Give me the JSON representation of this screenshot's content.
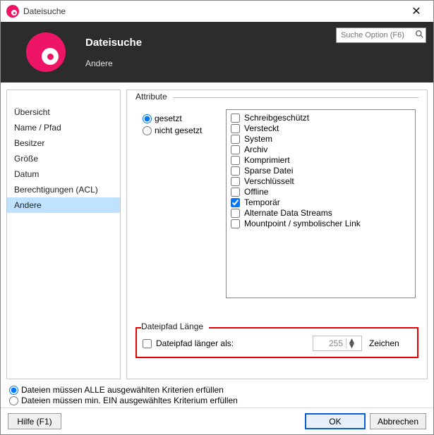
{
  "window": {
    "title": "Dateisuche"
  },
  "header": {
    "title": "Dateisuche",
    "subtitle": "Andere"
  },
  "search": {
    "placeholder": "Suche Option (F6)"
  },
  "sidebar": {
    "items": [
      {
        "label": "Übersicht"
      },
      {
        "label": "Name / Pfad"
      },
      {
        "label": "Besitzer"
      },
      {
        "label": "Größe"
      },
      {
        "label": "Datum"
      },
      {
        "label": "Berechtigungen (ACL)"
      },
      {
        "label": "Andere"
      }
    ],
    "selected": 6
  },
  "attributes": {
    "legend": "Attribute",
    "mode": {
      "set": "gesetzt",
      "unset": "nicht gesetzt",
      "selected": "set"
    },
    "list": [
      {
        "label": "Schreibgeschützt",
        "checked": false
      },
      {
        "label": "Versteckt",
        "checked": false
      },
      {
        "label": "System",
        "checked": false
      },
      {
        "label": "Archiv",
        "checked": false
      },
      {
        "label": "Komprimiert",
        "checked": false
      },
      {
        "label": "Sparse Datei",
        "checked": false
      },
      {
        "label": "Verschlüsselt",
        "checked": false
      },
      {
        "label": "Offline",
        "checked": false
      },
      {
        "label": "Temporär",
        "checked": true
      },
      {
        "label": "Alternate Data Streams",
        "checked": false
      },
      {
        "label": "Mountpoint / symbolischer Link",
        "checked": false
      }
    ]
  },
  "pathlen": {
    "legend": "Dateipfad Länge",
    "checkbox": "Dateipfad länger als:",
    "value": "255",
    "unit": "Zeichen"
  },
  "match": {
    "all": "Dateien müssen ALLE ausgewählten Kriterien erfüllen",
    "any": "Dateien müssen min. EIN ausgewähltes Kriterium erfüllen",
    "selected": "all"
  },
  "buttons": {
    "help": "Hilfe (F1)",
    "ok": "OK",
    "cancel": "Abbrechen"
  }
}
